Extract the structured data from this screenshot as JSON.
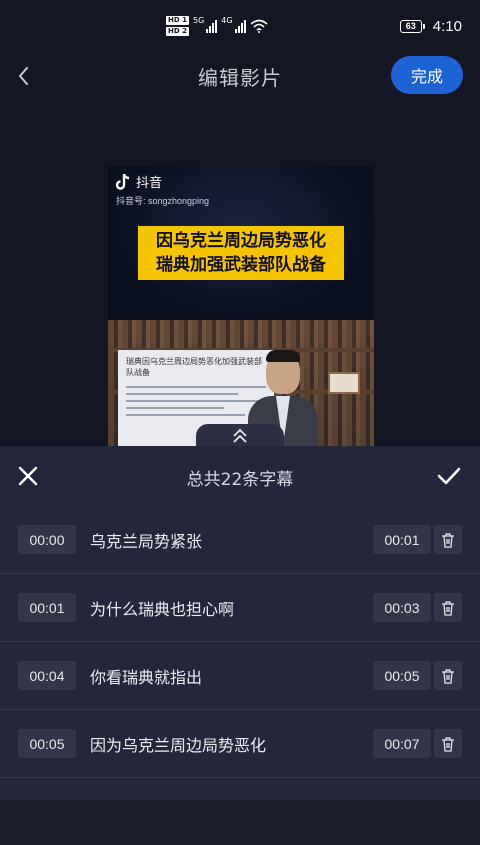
{
  "status_bar": {
    "hd1": "HD 1",
    "hd2": "HD 2",
    "net1": "5G",
    "net2": "4G",
    "battery": "63",
    "time": "4:10"
  },
  "header": {
    "back_icon": "chevron-left-icon",
    "title": "编辑影片",
    "done_label": "完成",
    "accent": "#1e63d6"
  },
  "preview": {
    "app_name": "抖音",
    "account_id": "抖音号: songzhongping",
    "headline_lines": [
      "因乌克兰周边局势恶化",
      "瑞典加强武装部队战备"
    ],
    "headline_bg": "#f5c400",
    "board_text": "瑞典因乌克兰周边局势恶化加强武装部队战备"
  },
  "subtitle_panel": {
    "close_icon": "close-icon",
    "title": "总共22条字幕",
    "confirm_icon": "checkmark-icon",
    "expand_icon": "chevrons-up-icon",
    "rows": [
      {
        "start": "00:00",
        "text": "乌克兰局势紧张",
        "end": "00:01"
      },
      {
        "start": "00:01",
        "text": "为什么瑞典也担心啊",
        "end": "00:03"
      },
      {
        "start": "00:04",
        "text": "你看瑞典就指出",
        "end": "00:05"
      },
      {
        "start": "00:05",
        "text": "因为乌克兰周边局势恶化",
        "end": "00:07"
      }
    ]
  }
}
